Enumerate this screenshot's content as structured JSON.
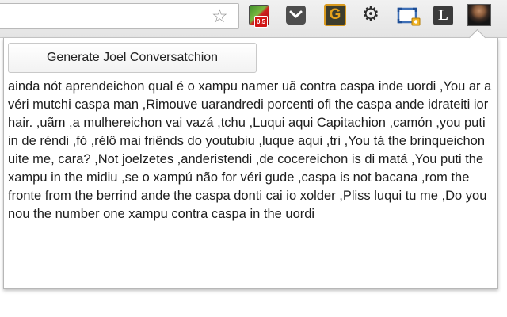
{
  "toolbar": {
    "bookmark_icon": "star-icon",
    "extensions": [
      {
        "name": "counter-extension-icon",
        "badge": "0.5"
      },
      {
        "name": "pocket-icon"
      },
      {
        "name": "g-extension-icon",
        "glyph": "G"
      },
      {
        "name": "gear-icon",
        "glyph": "⚙"
      },
      {
        "name": "screen-capture-icon"
      },
      {
        "name": "l-extension-icon",
        "glyph": "L"
      },
      {
        "name": "avatar-extension-icon"
      }
    ]
  },
  "popup": {
    "button_label": "Generate Joel Conversatchion",
    "conversation_text": "ainda nót aprendeichon qual é o xampu namer uã contra caspa inde uordi ,You ar a véri mutchi caspa man ,Rimouve uarandredi porcenti ofi the caspa ande idrateiti ior hair. ,uãm ,a mulhereichon vai vazá ,tchu ,Luqui aqui Capitachion ,camón ,you puti in de réndi ,fó ,rélô mai friênds do youtubiu ,luque aqui ,tri ,You tá the brinqueichon uite me, cara? ,Not joelzetes ,anderistendi ,de cocereichon is di matá ,You puti the xampu in the midiu ,se o xampú não for véri gude ,caspa is not bacana ,rom the fronte from the berrind ande the caspa donti cai io xolder ,Pliss luqui tu me ,Do you nou the number one xampu contra caspa in the uordi"
  },
  "colors": {
    "toolbar_bg": "#e9e9e9",
    "popup_border": "#b7b7b7",
    "text": "#1d1d1d"
  }
}
